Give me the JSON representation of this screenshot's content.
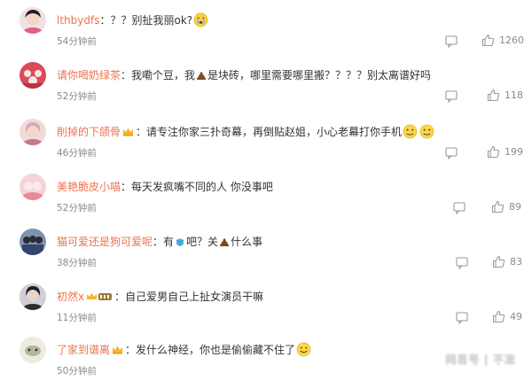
{
  "comments": [
    {
      "username": "lthbydfs",
      "separator": "：",
      "parts": [
        "？？别扯我丽ok?"
      ],
      "time": "54分钟前",
      "likes": "1260",
      "avatar_color": "#e9d2d5"
    },
    {
      "username": "请你喝奶绿茶",
      "separator": "：",
      "parts": [
        "我嘞个豆，我",
        "是块砖，哪里需要哪里搬？？？？别太离谱好吗"
      ],
      "time": "52分钟前",
      "likes": "118",
      "avatar_color": "#d94a5b"
    },
    {
      "username": "削掉的下颌骨",
      "separator": "：",
      "parts": [
        "请专注你家三扑奇幕，再倒贴赵姐，小心老幕打你手机"
      ],
      "time": "46分钟前",
      "likes": "199",
      "avatar_color": "#e8c5c9"
    },
    {
      "username": "美艳脆皮小喵",
      "separator": "：",
      "parts": [
        "每天发疯嘴不同的人 你没事吧"
      ],
      "time": "52分钟前",
      "likes": "89",
      "avatar_color": "#f0c4c9"
    },
    {
      "username": "猫可爱还是狗可爱呢",
      "separator": "：",
      "parts": [
        "有",
        "吧？关",
        "什么事"
      ],
      "time": "38分钟前",
      "likes": "83",
      "avatar_color": "#5b6c87"
    },
    {
      "username": "初然x",
      "separator": "：",
      "parts": [
        "自己爱男自己上扯女演员干嘛"
      ],
      "time": "11分钟前",
      "likes": "49",
      "avatar_color": "#3b3b42"
    },
    {
      "username": "了家到谱离",
      "separator": "：",
      "parts": [
        "发什么神经，你也是偷偷藏不住了"
      ],
      "time": "50分钟前",
      "likes": "",
      "avatar_color": "#d8d8c8"
    }
  ],
  "watermark": "网易号 | 不准",
  "colors": {
    "username": "#eb7350",
    "time": "#8a8a8a",
    "text": "#333333"
  }
}
